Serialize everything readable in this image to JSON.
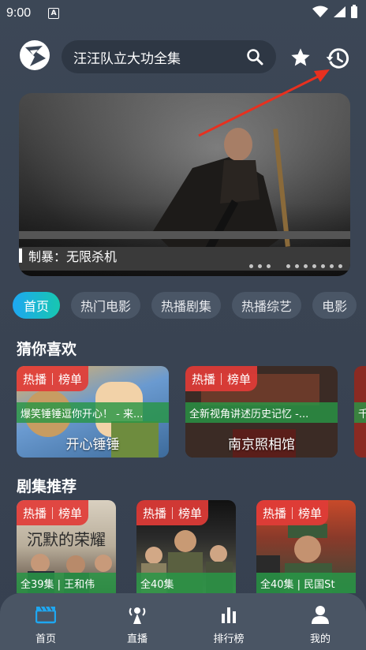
{
  "status_bar": {
    "time": "9:00",
    "notif_letter": "A"
  },
  "header": {
    "search_value": "汪汪队立大功全集",
    "icons": [
      "logo",
      "search-icon",
      "star-icon",
      "history-icon"
    ]
  },
  "banner": {
    "caption": "制暴：无限杀机",
    "page_dots": 10
  },
  "tabs": [
    "首页",
    "热门电影",
    "热播剧集",
    "热播综艺",
    "电影"
  ],
  "sections": {
    "guess_title": "猜你喜欢",
    "drama_title": "剧集推荐"
  },
  "badge_text": "热播｜榜单",
  "guess_cards": [
    {
      "subtitle": "爆笑锤锤逗你开心！ - 来...",
      "name": "开心锤锤"
    },
    {
      "subtitle": "全新视角讲述历史记忆 -...",
      "name": "南京照相馆"
    },
    {
      "subtitle": "千",
      "name": ""
    }
  ],
  "drama_cards": [
    {
      "poster_title": "沉默的荣耀",
      "footer": "全39集 | 王和伟"
    },
    {
      "poster_title": "",
      "footer": "全40集"
    },
    {
      "poster_title": "",
      "footer": "全40集 | 民国St"
    }
  ],
  "bottom_nav": [
    {
      "label": "首页",
      "icon": "clapperboard-icon",
      "active": true
    },
    {
      "label": "直播",
      "icon": "live-antenna-icon",
      "active": false
    },
    {
      "label": "排行榜",
      "icon": "bar-chart-icon",
      "active": false
    },
    {
      "label": "我的",
      "icon": "person-icon",
      "active": false
    }
  ],
  "colors": {
    "accent_start": "#1ea7f1",
    "accent_end": "#17c7b0",
    "badge": "#e13c37",
    "card_strip": "#28964",
    "annotation_arrow": "#e8301f"
  }
}
